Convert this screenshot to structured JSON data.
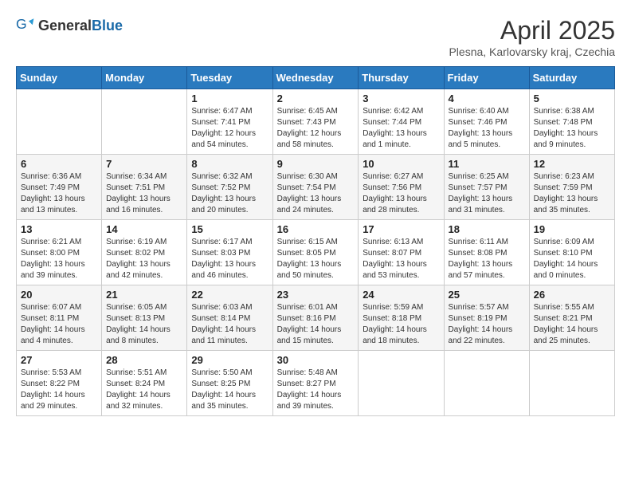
{
  "header": {
    "logo_general": "General",
    "logo_blue": "Blue",
    "title": "April 2025",
    "subtitle": "Plesna, Karlovarsky kraj, Czechia"
  },
  "weekdays": [
    "Sunday",
    "Monday",
    "Tuesday",
    "Wednesday",
    "Thursday",
    "Friday",
    "Saturday"
  ],
  "weeks": [
    [
      {
        "day": "",
        "info": ""
      },
      {
        "day": "",
        "info": ""
      },
      {
        "day": "1",
        "info": "Sunrise: 6:47 AM\nSunset: 7:41 PM\nDaylight: 12 hours and 54 minutes."
      },
      {
        "day": "2",
        "info": "Sunrise: 6:45 AM\nSunset: 7:43 PM\nDaylight: 12 hours and 58 minutes."
      },
      {
        "day": "3",
        "info": "Sunrise: 6:42 AM\nSunset: 7:44 PM\nDaylight: 13 hours and 1 minute."
      },
      {
        "day": "4",
        "info": "Sunrise: 6:40 AM\nSunset: 7:46 PM\nDaylight: 13 hours and 5 minutes."
      },
      {
        "day": "5",
        "info": "Sunrise: 6:38 AM\nSunset: 7:48 PM\nDaylight: 13 hours and 9 minutes."
      }
    ],
    [
      {
        "day": "6",
        "info": "Sunrise: 6:36 AM\nSunset: 7:49 PM\nDaylight: 13 hours and 13 minutes."
      },
      {
        "day": "7",
        "info": "Sunrise: 6:34 AM\nSunset: 7:51 PM\nDaylight: 13 hours and 16 minutes."
      },
      {
        "day": "8",
        "info": "Sunrise: 6:32 AM\nSunset: 7:52 PM\nDaylight: 13 hours and 20 minutes."
      },
      {
        "day": "9",
        "info": "Sunrise: 6:30 AM\nSunset: 7:54 PM\nDaylight: 13 hours and 24 minutes."
      },
      {
        "day": "10",
        "info": "Sunrise: 6:27 AM\nSunset: 7:56 PM\nDaylight: 13 hours and 28 minutes."
      },
      {
        "day": "11",
        "info": "Sunrise: 6:25 AM\nSunset: 7:57 PM\nDaylight: 13 hours and 31 minutes."
      },
      {
        "day": "12",
        "info": "Sunrise: 6:23 AM\nSunset: 7:59 PM\nDaylight: 13 hours and 35 minutes."
      }
    ],
    [
      {
        "day": "13",
        "info": "Sunrise: 6:21 AM\nSunset: 8:00 PM\nDaylight: 13 hours and 39 minutes."
      },
      {
        "day": "14",
        "info": "Sunrise: 6:19 AM\nSunset: 8:02 PM\nDaylight: 13 hours and 42 minutes."
      },
      {
        "day": "15",
        "info": "Sunrise: 6:17 AM\nSunset: 8:03 PM\nDaylight: 13 hours and 46 minutes."
      },
      {
        "day": "16",
        "info": "Sunrise: 6:15 AM\nSunset: 8:05 PM\nDaylight: 13 hours and 50 minutes."
      },
      {
        "day": "17",
        "info": "Sunrise: 6:13 AM\nSunset: 8:07 PM\nDaylight: 13 hours and 53 minutes."
      },
      {
        "day": "18",
        "info": "Sunrise: 6:11 AM\nSunset: 8:08 PM\nDaylight: 13 hours and 57 minutes."
      },
      {
        "day": "19",
        "info": "Sunrise: 6:09 AM\nSunset: 8:10 PM\nDaylight: 14 hours and 0 minutes."
      }
    ],
    [
      {
        "day": "20",
        "info": "Sunrise: 6:07 AM\nSunset: 8:11 PM\nDaylight: 14 hours and 4 minutes."
      },
      {
        "day": "21",
        "info": "Sunrise: 6:05 AM\nSunset: 8:13 PM\nDaylight: 14 hours and 8 minutes."
      },
      {
        "day": "22",
        "info": "Sunrise: 6:03 AM\nSunset: 8:14 PM\nDaylight: 14 hours and 11 minutes."
      },
      {
        "day": "23",
        "info": "Sunrise: 6:01 AM\nSunset: 8:16 PM\nDaylight: 14 hours and 15 minutes."
      },
      {
        "day": "24",
        "info": "Sunrise: 5:59 AM\nSunset: 8:18 PM\nDaylight: 14 hours and 18 minutes."
      },
      {
        "day": "25",
        "info": "Sunrise: 5:57 AM\nSunset: 8:19 PM\nDaylight: 14 hours and 22 minutes."
      },
      {
        "day": "26",
        "info": "Sunrise: 5:55 AM\nSunset: 8:21 PM\nDaylight: 14 hours and 25 minutes."
      }
    ],
    [
      {
        "day": "27",
        "info": "Sunrise: 5:53 AM\nSunset: 8:22 PM\nDaylight: 14 hours and 29 minutes."
      },
      {
        "day": "28",
        "info": "Sunrise: 5:51 AM\nSunset: 8:24 PM\nDaylight: 14 hours and 32 minutes."
      },
      {
        "day": "29",
        "info": "Sunrise: 5:50 AM\nSunset: 8:25 PM\nDaylight: 14 hours and 35 minutes."
      },
      {
        "day": "30",
        "info": "Sunrise: 5:48 AM\nSunset: 8:27 PM\nDaylight: 14 hours and 39 minutes."
      },
      {
        "day": "",
        "info": ""
      },
      {
        "day": "",
        "info": ""
      },
      {
        "day": "",
        "info": ""
      }
    ]
  ]
}
